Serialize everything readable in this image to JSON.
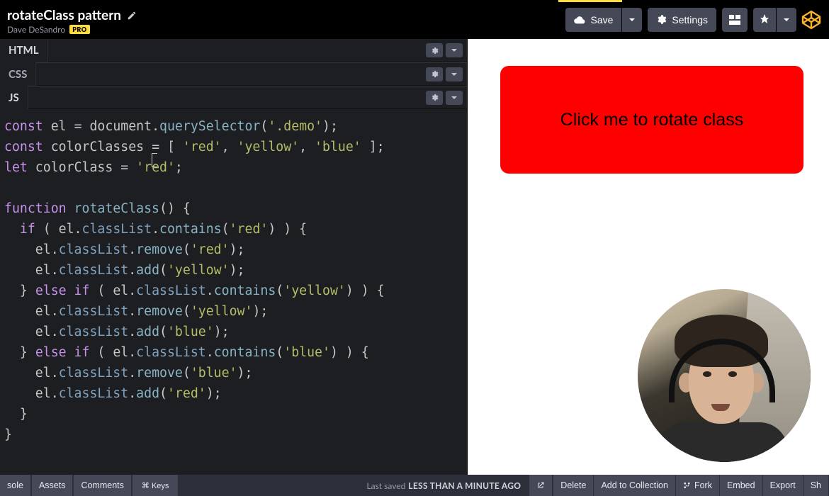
{
  "header": {
    "title": "rotateClass pattern",
    "author": "Dave DeSandro",
    "pro_badge": "PRO",
    "save": "Save",
    "settings": "Settings"
  },
  "panels": {
    "html": "HTML",
    "css": "CSS",
    "js": "JS"
  },
  "code": {
    "l1a": "const",
    "l1b": " el ",
    "l1c": "=",
    "l1d": " document",
    "l1e": ".",
    "l1f": "querySelector",
    "l1g": "(",
    "l1h": "'.demo'",
    "l1i": ");",
    "l2a": "const",
    "l2b": " colorClasses ",
    "l2c": "=",
    "l2d": " [ ",
    "l2e": "'red'",
    "l2f": ", ",
    "l2g": "'yellow'",
    "l2h": ", ",
    "l2i": "'blue'",
    "l2j": " ];",
    "l3a": "let",
    "l3b": " colorClass ",
    "l3c": "=",
    "l3d": " ",
    "l3e": "'red'",
    "l3f": ";",
    "l5a": "function",
    "l5b": " rotateClass",
    "l5c": "() {",
    "l6a": "  if",
    "l6b": " ( el.",
    "l6c": "classList",
    "l6d": ".",
    "l6e": "contains",
    "l6f": "(",
    "l6g": "'red'",
    "l6h": ") ) {",
    "l7a": "    el.",
    "l7b": "classList",
    "l7c": ".",
    "l7d": "remove",
    "l7e": "(",
    "l7f": "'red'",
    "l7g": ");",
    "l8a": "    el.",
    "l8b": "classList",
    "l8c": ".",
    "l8d": "add",
    "l8e": "(",
    "l8f": "'yellow'",
    "l8g": ");",
    "l9a": "  } ",
    "l9b": "else if",
    "l9c": " ( el.",
    "l9d": "classList",
    "l9e": ".",
    "l9f": "contains",
    "l9g": "(",
    "l9h": "'yellow'",
    "l9i": ") ) {",
    "l10a": "    el.",
    "l10b": "classList",
    "l10c": ".",
    "l10d": "remove",
    "l10e": "(",
    "l10f": "'yellow'",
    "l10g": ");",
    "l11a": "    el.",
    "l11b": "classList",
    "l11c": ".",
    "l11d": "add",
    "l11e": "(",
    "l11f": "'blue'",
    "l11g": ");",
    "l12a": "  } ",
    "l12b": "else if",
    "l12c": " ( el.",
    "l12d": "classList",
    "l12e": ".",
    "l12f": "contains",
    "l12g": "(",
    "l12h": "'blue'",
    "l12i": ") ) {",
    "l13a": "    el.",
    "l13b": "classList",
    "l13c": ".",
    "l13d": "remove",
    "l13e": "(",
    "l13f": "'blue'",
    "l13g": ");",
    "l14a": "    el.",
    "l14b": "classList",
    "l14c": ".",
    "l14d": "add",
    "l14e": "(",
    "l14f": "'red'",
    "l14g": ");",
    "l15": "  }",
    "l16": "}"
  },
  "preview": {
    "demo_text": "Click me to rotate class",
    "active_class": "red",
    "color_hex": "#ff0000"
  },
  "footer": {
    "console": "sole",
    "assets": "Assets",
    "comments": "Comments",
    "keys": "⌘ Keys",
    "saved_prefix": "Last saved",
    "saved_value": "LESS THAN A MINUTE AGO",
    "delete": "Delete",
    "add": "Add to Collection",
    "fork": "Fork",
    "embed": "Embed",
    "export": "Export",
    "share": "Sh"
  }
}
